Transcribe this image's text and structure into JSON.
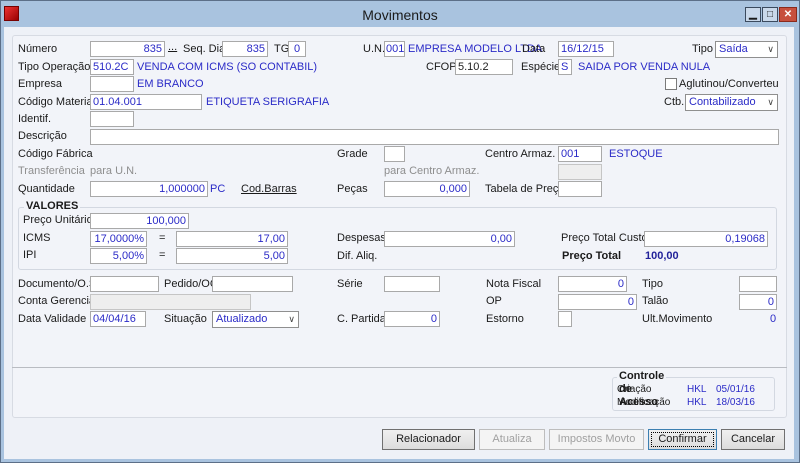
{
  "window": {
    "title": "Movimentos",
    "minimize": "▁",
    "maximize": "□",
    "close": "✕"
  },
  "form": {
    "numero": {
      "label": "Número",
      "value": "835",
      "lookup": "..."
    },
    "seq_dia": {
      "label": "Seq. Dia",
      "value": "835"
    },
    "tg": {
      "label": "TG",
      "value": "0"
    },
    "un": {
      "label": "U.N.",
      "value": "001",
      "desc": "EMPRESA MODELO LTDA"
    },
    "data": {
      "label": "Data",
      "value": "16/12/15"
    },
    "tipo": {
      "label": "Tipo",
      "value": "Saída"
    },
    "tipo_operacao": {
      "label": "Tipo Operação",
      "value": "510.2C",
      "desc": "VENDA COM ICMS (SO CONTABIL)"
    },
    "cfop": {
      "label": "CFOP",
      "value": "5.10.2"
    },
    "especie": {
      "label": "Espécie",
      "value": "S",
      "desc": "SAIDA POR VENDA NULA"
    },
    "empresa": {
      "label": "Empresa",
      "value": "",
      "desc": "EM BRANCO"
    },
    "aglutinou": {
      "label": "Aglutinou/Converteu",
      "checked": false
    },
    "codigo_material": {
      "label": "Código Material",
      "value": "01.04.001",
      "desc": "ETIQUETA SERIGRAFIA"
    },
    "ctb": {
      "label": "Ctb.",
      "value": "Contabilizado"
    },
    "identif": {
      "label": "Identif.",
      "value": ""
    },
    "descricao": {
      "label": "Descrição",
      "value": ""
    },
    "codigo_fabrica": {
      "label": "Código Fábrica"
    },
    "grade": {
      "label": "Grade",
      "value": ""
    },
    "centro_armaz": {
      "label": "Centro Armaz.",
      "value": "001",
      "desc": "ESTOQUE"
    },
    "transferencia": {
      "label": "Transferência",
      "para_un": "para U.N.",
      "para_centro": "para Centro Armaz."
    },
    "quantidade": {
      "label": "Quantidade",
      "value": "1,000000",
      "unit": "PC",
      "cod_barras": "Cod.Barras"
    },
    "pecas": {
      "label": "Peças",
      "value": "0,000"
    },
    "tabela_preco": {
      "label": "Tabela de Preço",
      "value": ""
    }
  },
  "valores": {
    "title": "VALORES",
    "preco_unitario": {
      "label": "Preço Unitário",
      "value": "100,000"
    },
    "icms": {
      "label": "ICMS",
      "pct": "17,0000%",
      "eq": "=",
      "value": "17,00"
    },
    "ipi": {
      "label": "IPI",
      "pct": "5,00%",
      "eq": "=",
      "value": "5,00"
    },
    "despesas": {
      "label": "Despesas",
      "value": "0,00"
    },
    "dif_aliq": {
      "label": "Dif. Aliq."
    },
    "preco_total_custo": {
      "label": "Preço Total Custo",
      "value": "0,19068"
    },
    "preco_total": {
      "label": "Preço Total",
      "value": "100,00"
    }
  },
  "extra": {
    "documento": {
      "label": "Documento/O.S",
      "value": ""
    },
    "pedido": {
      "label": "Pedido/OC",
      "value": ""
    },
    "serie": {
      "label": "Série",
      "value": ""
    },
    "nota_fiscal": {
      "label": "Nota Fiscal",
      "value": "0"
    },
    "tipo2": {
      "label": "Tipo",
      "value": ""
    },
    "conta_gerencial": {
      "label": "Conta Gerencial",
      "value": ""
    },
    "op": {
      "label": "OP",
      "value": "0"
    },
    "talao": {
      "label": "Talão",
      "value": "0"
    },
    "data_validade": {
      "label": "Data Validade",
      "value": "04/04/16"
    },
    "situacao": {
      "label": "Situação",
      "value": "Atualizado"
    },
    "c_partida": {
      "label": "C. Partida",
      "value": "0"
    },
    "estorno": {
      "label": "Estorno",
      "value": ""
    },
    "ult_movimento": {
      "label": "Ult.Movimento",
      "value": "0"
    }
  },
  "controle": {
    "title": "Controle de Acesso",
    "criacao": {
      "label": "Criação",
      "user": "HKL",
      "date": "05/01/16"
    },
    "modificacao": {
      "label": "Modificação",
      "user": "HKL",
      "date": "18/03/16"
    }
  },
  "buttons": {
    "relacionador": "Relacionador",
    "atualiza": "Atualiza",
    "impostos": "Impostos Movto",
    "confirmar": "Confirmar",
    "cancelar": "Cancelar"
  }
}
